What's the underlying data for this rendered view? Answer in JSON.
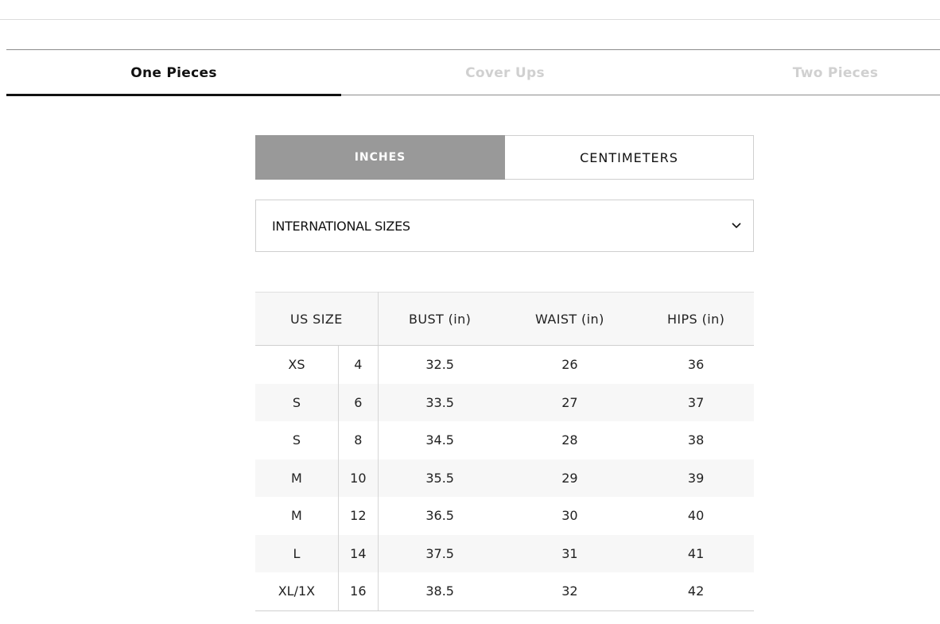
{
  "tabs": [
    {
      "label": "One Pieces",
      "active": true
    },
    {
      "label": "Cover Ups",
      "active": false
    },
    {
      "label": "Two Pieces",
      "active": false
    }
  ],
  "units": {
    "inches": "INCHES",
    "centimeters": "CENTIMETERS",
    "selected": "INCHES"
  },
  "size_select": {
    "value": "INTERNATIONAL SIZES",
    "icon": "chevron-down-icon"
  },
  "size_table": {
    "headers": [
      "US SIZE",
      "BUST (in)",
      "WAIST (in)",
      "HIPS (in)"
    ],
    "rows": [
      {
        "size": "XS",
        "num": "4",
        "bust": "32.5",
        "waist": "26",
        "hips": "36"
      },
      {
        "size": "S",
        "num": "6",
        "bust": "33.5",
        "waist": "27",
        "hips": "37"
      },
      {
        "size": "S",
        "num": "8",
        "bust": "34.5",
        "waist": "28",
        "hips": "38"
      },
      {
        "size": "M",
        "num": "10",
        "bust": "35.5",
        "waist": "29",
        "hips": "39"
      },
      {
        "size": "M",
        "num": "12",
        "bust": "36.5",
        "waist": "30",
        "hips": "40"
      },
      {
        "size": "L",
        "num": "14",
        "bust": "37.5",
        "waist": "31",
        "hips": "41"
      },
      {
        "size": "XL/1X",
        "num": "16",
        "bust": "38.5",
        "waist": "32",
        "hips": "42"
      }
    ]
  },
  "colors": {
    "active_tab": "#111111",
    "inactive_tab": "#d0d0d0",
    "unit_active_bg": "#999999",
    "row_shade": "#f7f7f7"
  }
}
